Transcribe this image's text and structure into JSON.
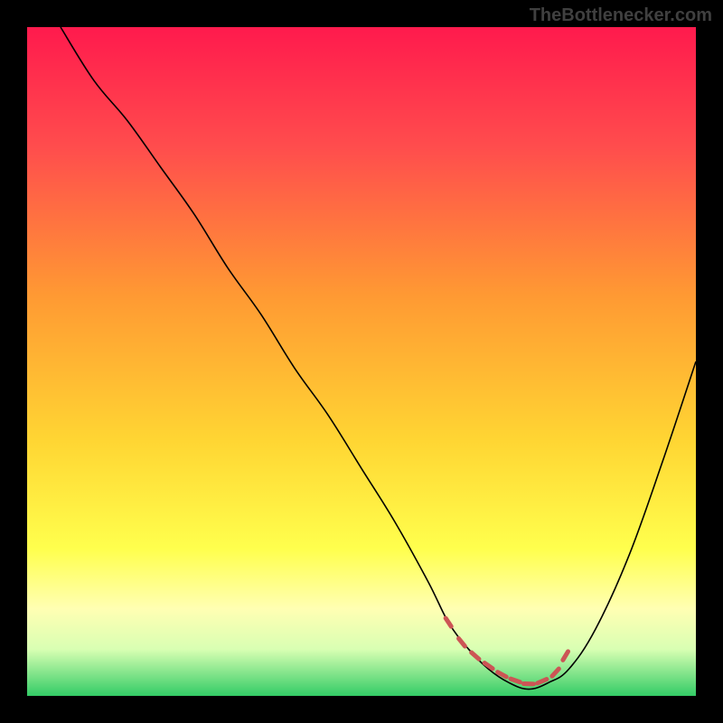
{
  "watermark": "TheBottlenecker.com",
  "chart_data": {
    "type": "line",
    "title": "",
    "xlabel": "",
    "ylabel": "",
    "xlim": [
      0,
      100
    ],
    "ylim": [
      0,
      100
    ],
    "background_gradient": {
      "stops": [
        {
          "offset": 0,
          "color": "#ff1a4d"
        },
        {
          "offset": 18,
          "color": "#ff4d4d"
        },
        {
          "offset": 40,
          "color": "#ff9933"
        },
        {
          "offset": 62,
          "color": "#ffd633"
        },
        {
          "offset": 78,
          "color": "#ffff4d"
        },
        {
          "offset": 87,
          "color": "#ffffb3"
        },
        {
          "offset": 93,
          "color": "#d9ffb3"
        },
        {
          "offset": 100,
          "color": "#33cc66"
        }
      ]
    },
    "series": [
      {
        "name": "bottleneck-curve",
        "color": "#000000",
        "width": 1.5,
        "x": [
          5,
          10,
          15,
          20,
          25,
          30,
          35,
          40,
          45,
          50,
          55,
          60,
          63,
          66,
          69,
          72,
          75,
          78,
          81,
          85,
          90,
          95,
          100
        ],
        "y": [
          100,
          92,
          86,
          79,
          72,
          64,
          57,
          49,
          42,
          34,
          26,
          17,
          11,
          7,
          4,
          2,
          1,
          2,
          4,
          10,
          21,
          35,
          50
        ]
      },
      {
        "name": "optimal-zone-markers",
        "color": "#cc5555",
        "style": "dashed-thick",
        "x": [
          63,
          65,
          67,
          69,
          71,
          73,
          75,
          77,
          79,
          80.5
        ],
        "y": [
          11,
          8,
          6,
          4.5,
          3.2,
          2.3,
          1.8,
          2.2,
          3.5,
          6
        ]
      }
    ]
  }
}
